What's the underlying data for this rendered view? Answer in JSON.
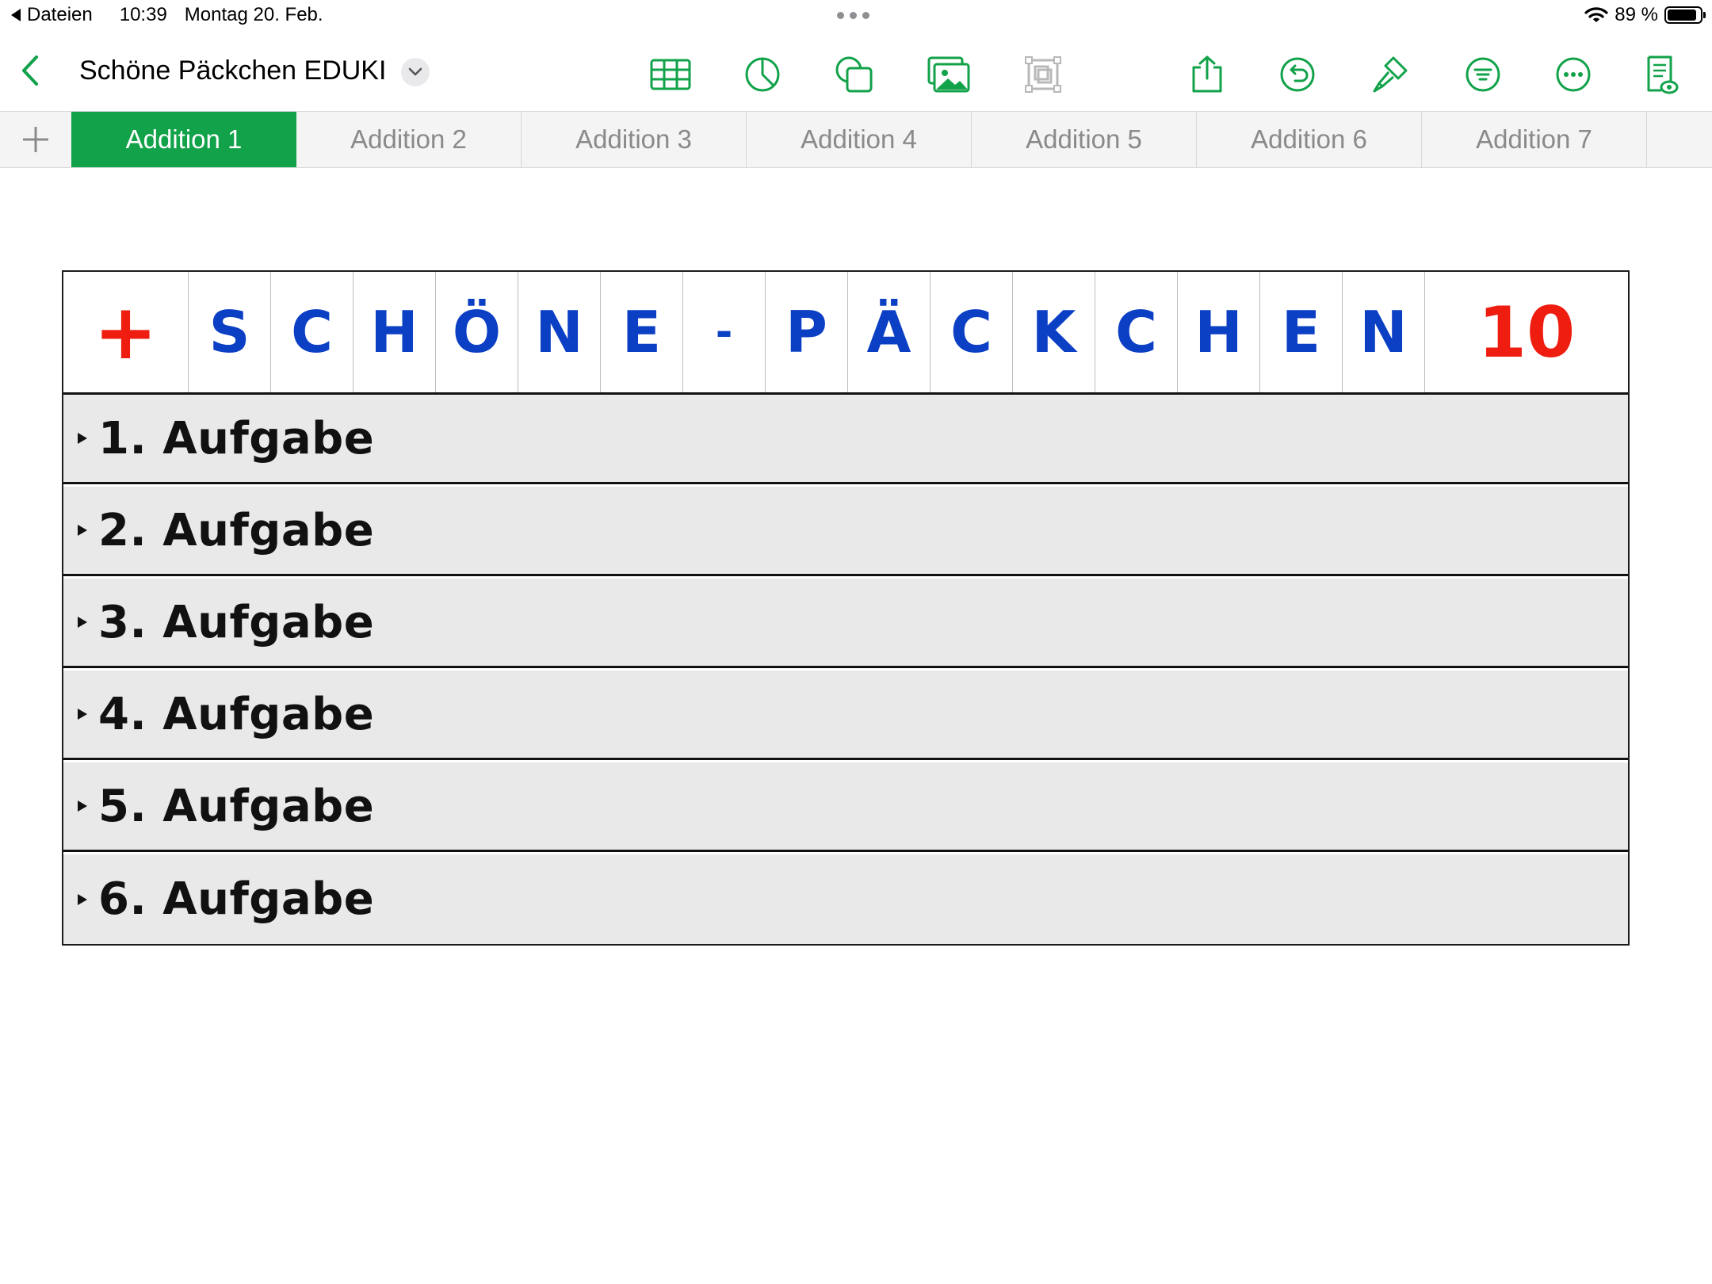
{
  "status_bar": {
    "back_app": "Dateien",
    "time": "10:39",
    "date": "Montag 20. Feb.",
    "battery_text": "89 %",
    "battery_level": 0.89
  },
  "toolbar": {
    "title": "Schöne Päckchen EDUKI",
    "accent_color": "#11a24a",
    "icons": [
      "table-icon",
      "chart-icon",
      "shapes-icon",
      "media-icon",
      "comment-frame-icon",
      "share-icon",
      "undo-icon",
      "format-brush-icon",
      "filter-icon",
      "more-icon",
      "document-view-icon"
    ]
  },
  "sheet_tabs": [
    {
      "label": "Addition 1",
      "active": true
    },
    {
      "label": "Addition 2",
      "active": false
    },
    {
      "label": "Addition 3",
      "active": false
    },
    {
      "label": "Addition 4",
      "active": false
    },
    {
      "label": "Addition 5",
      "active": false
    },
    {
      "label": "Addition 6",
      "active": false
    },
    {
      "label": "Addition 7",
      "active": false
    }
  ],
  "worksheet": {
    "operator": "+",
    "letters": [
      "S",
      "C",
      "H",
      "Ö",
      "N",
      "E",
      "-",
      "P",
      "Ä",
      "C",
      "K",
      "C",
      "H",
      "E",
      "N"
    ],
    "count": "10",
    "letter_color": "#0b3fc4",
    "operator_color": "#ee1d10",
    "tasks": [
      "1. Aufgabe",
      "2. Aufgabe",
      "3. Aufgabe",
      "4. Aufgabe",
      "5. Aufgabe",
      "6. Aufgabe"
    ]
  }
}
